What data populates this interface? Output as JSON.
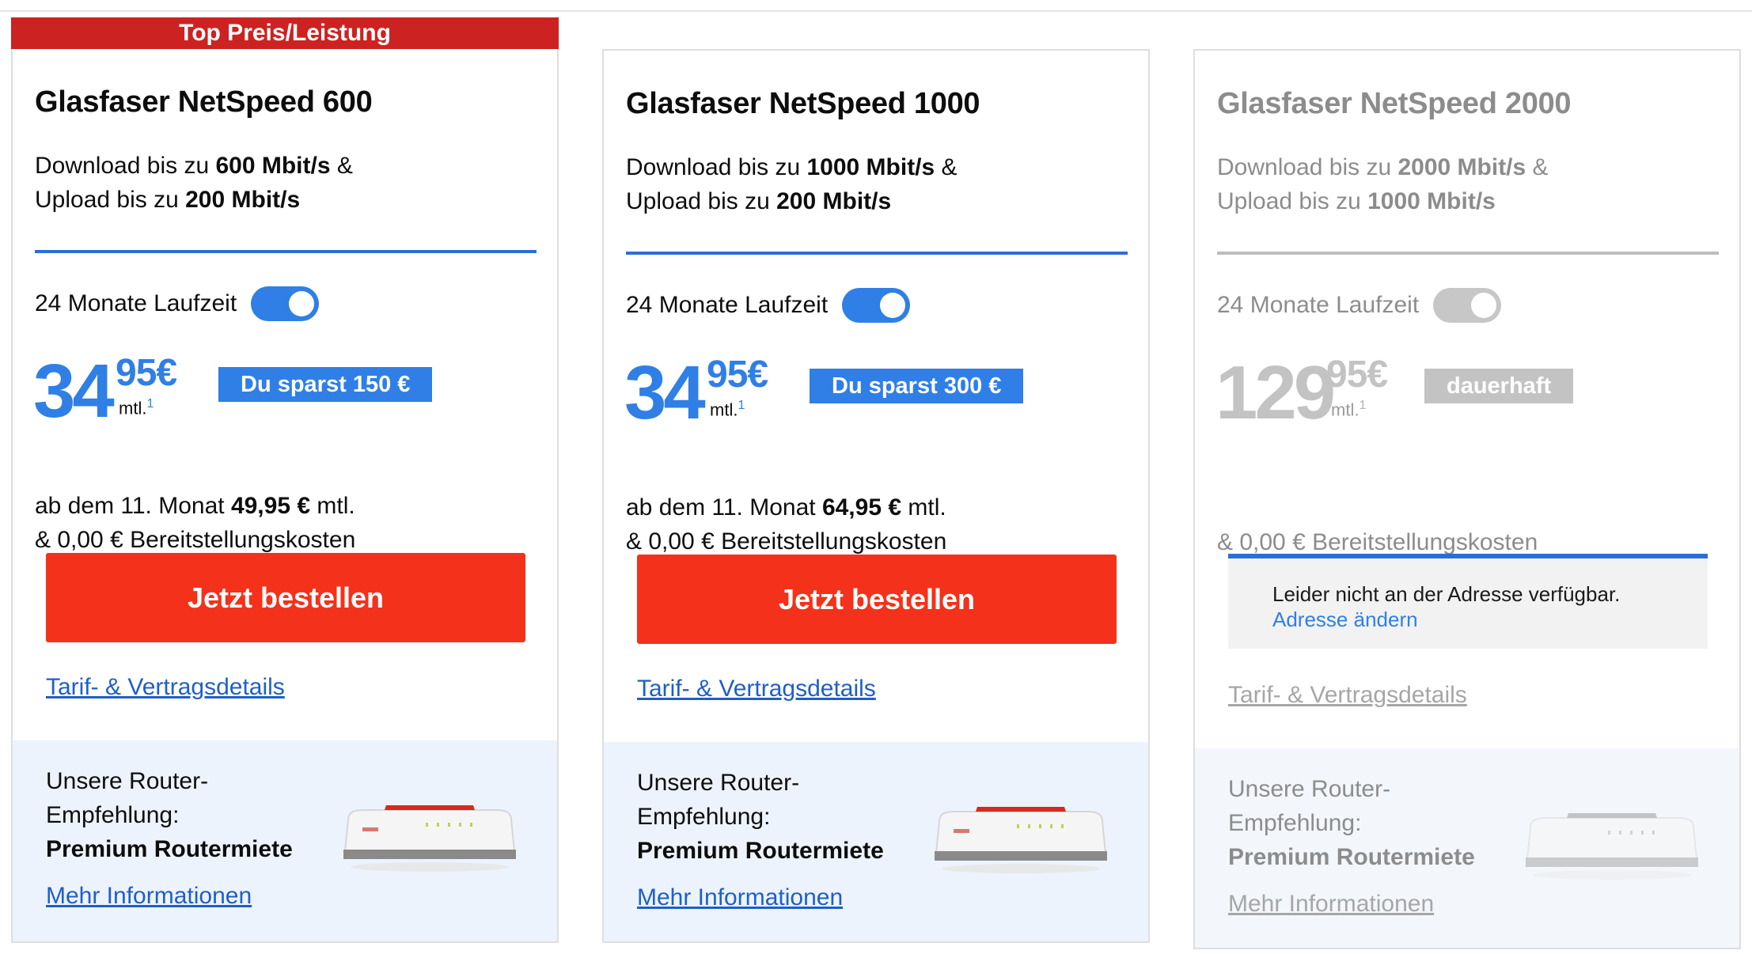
{
  "badge": "Top Preis/Leistung",
  "plans": [
    {
      "title": "Glasfaser NetSpeed 600",
      "speed_prefix1": "Download bis zu ",
      "speed_down": "600 Mbit/s",
      "speed_suffix1": " &",
      "speed_prefix2": "Upload bis zu ",
      "speed_up": "200 Mbit/s",
      "term": "24 Monate Laufzeit",
      "term_toggle_on": true,
      "price_euros": "34",
      "price_cents": "95€",
      "price_unit": "mtl.",
      "price_footnote": "1",
      "savings": "Du sparst 150 €",
      "after_prefix": "ab dem 11. Monat ",
      "after_price": "49,95 €",
      "after_suffix": " mtl.",
      "setup_cost": "& 0,00 € Bereitstellungskosten",
      "order_button": "Jetzt bestellen",
      "details_link": "Tarif- & Vertragsdetails",
      "router_line1": "Unsere Router-",
      "router_line2": "Empfehlung:",
      "router_name": "Premium Routermiete",
      "router_more": "Mehr Informationen"
    },
    {
      "title": "Glasfaser NetSpeed 1000",
      "speed_prefix1": "Download bis zu ",
      "speed_down": "1000 Mbit/s",
      "speed_suffix1": " &",
      "speed_prefix2": "Upload bis zu ",
      "speed_up": "200 Mbit/s",
      "term": "24 Monate Laufzeit",
      "term_toggle_on": true,
      "price_euros": "34",
      "price_cents": "95€",
      "price_unit": "mtl.",
      "price_footnote": "1",
      "savings": "Du sparst 300 €",
      "after_prefix": "ab dem 11. Monat ",
      "after_price": "64,95 €",
      "after_suffix": " mtl.",
      "setup_cost": "& 0,00 € Bereitstellungskosten",
      "order_button": "Jetzt bestellen",
      "details_link": "Tarif- & Vertragsdetails",
      "router_line1": "Unsere Router-",
      "router_line2": "Empfehlung:",
      "router_name": "Premium Routermiete",
      "router_more": "Mehr Informationen"
    },
    {
      "title": "Glasfaser NetSpeed 2000",
      "speed_prefix1": "Download bis zu ",
      "speed_down": "2000 Mbit/s",
      "speed_suffix1": " &",
      "speed_prefix2": "Upload bis zu ",
      "speed_up": "1000 Mbit/s",
      "term": "24 Monate Laufzeit",
      "term_toggle_on": false,
      "price_euros": "129",
      "price_cents": "95€",
      "price_unit": "mtl.",
      "price_footnote": "1",
      "savings": "dauerhaft",
      "setup_cost": "& 0,00 € Bereitstellungskosten",
      "unavailable_msg": "Leider nicht an der Adresse verfügbar.",
      "change_address": "Adresse ändern",
      "details_link": "Tarif- & Vertragsdetails",
      "router_line1": "Unsere Router-",
      "router_line2": "Empfehlung:",
      "router_name": "Premium Routermiete",
      "router_more": "Mehr Informationen"
    }
  ],
  "colors": {
    "accent_blue": "#2f7fe6",
    "order_red": "#f4311a",
    "badge_red": "#cc2222",
    "disabled_gray": "#c3c3c3"
  }
}
